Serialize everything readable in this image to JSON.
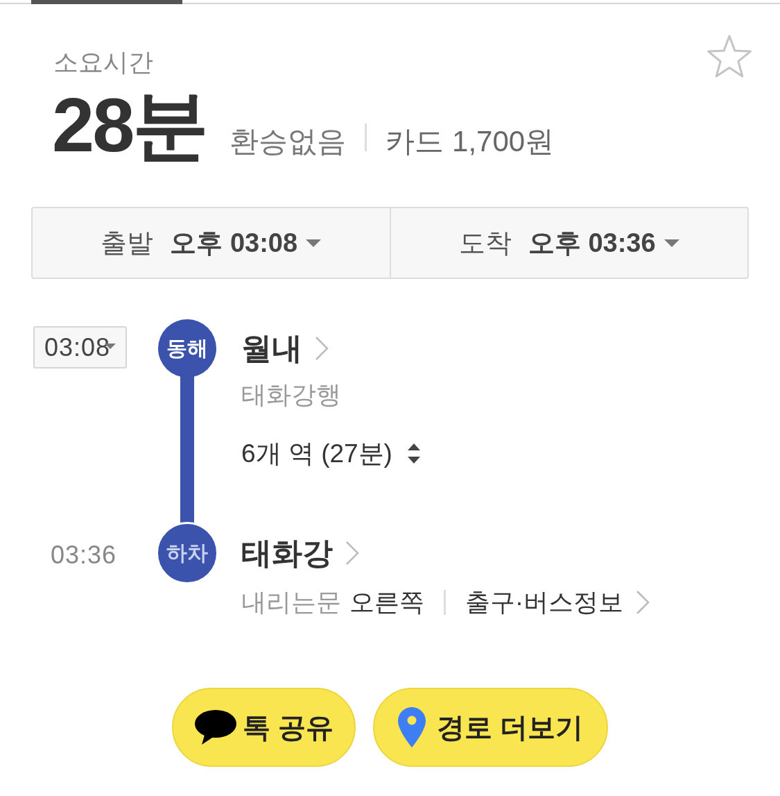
{
  "header": {
    "label": "소요시간",
    "favorite": false
  },
  "summary": {
    "duration": "28분",
    "transfers": "환승없음",
    "fare": "카드 1,700원"
  },
  "time_selector": [
    {
      "label": "출발",
      "time": "오후 03:08"
    },
    {
      "label": "도착",
      "time": "오후 03:36"
    }
  ],
  "route": {
    "stops": [
      {
        "kind": "board",
        "time": "03:08",
        "badge": "동해",
        "name": "월내",
        "direction": "태화강행",
        "stations": "6개 역 (27분)"
      },
      {
        "kind": "alight",
        "time": "03:36",
        "badge": "하차",
        "name": "태화강",
        "door_label": "내리는문",
        "door_side": "오른쪽",
        "exit_link": "출구·버스정보"
      }
    ]
  },
  "buttons": [
    {
      "kind": "share",
      "label": "톡 공유"
    },
    {
      "kind": "more",
      "label": "경로 더보기"
    }
  ]
}
